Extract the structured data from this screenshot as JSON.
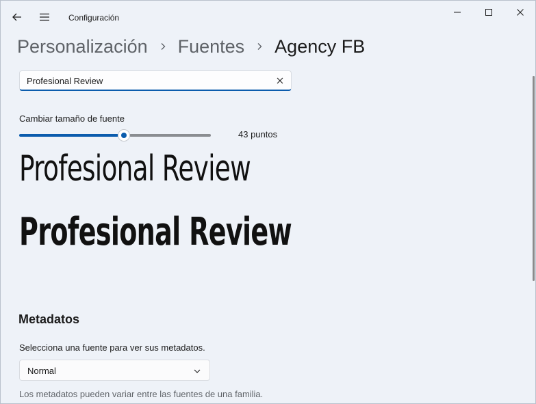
{
  "app": {
    "title": "Configuración"
  },
  "breadcrumb": [
    "Personalización",
    "Fuentes",
    "Agency FB"
  ],
  "search": {
    "value": "Profesional Review"
  },
  "font_size": {
    "label": "Cambiar tamaño de fuente",
    "value_label": "43 puntos",
    "fraction": 0.545
  },
  "preview": {
    "regular_text": "Profesional Review",
    "bold_text": "Profesional Review"
  },
  "metadata": {
    "title": "Metadatos",
    "hint": "Selecciona una fuente para ver sus metadatos.",
    "selected": "Normal",
    "note": "Los metadatos pueden variar entre las fuentes de una familia."
  },
  "colors": {
    "accent": "#0b5cad",
    "background": "#eef2f8"
  },
  "icons": {
    "back": "back-arrow-icon",
    "menu": "hamburger-menu-icon",
    "minimize": "minimize-icon",
    "maximize": "maximize-icon",
    "close": "close-icon",
    "chevron": "chevron-right-icon",
    "clear": "clear-x-icon",
    "dropdown": "chevron-down-icon"
  }
}
